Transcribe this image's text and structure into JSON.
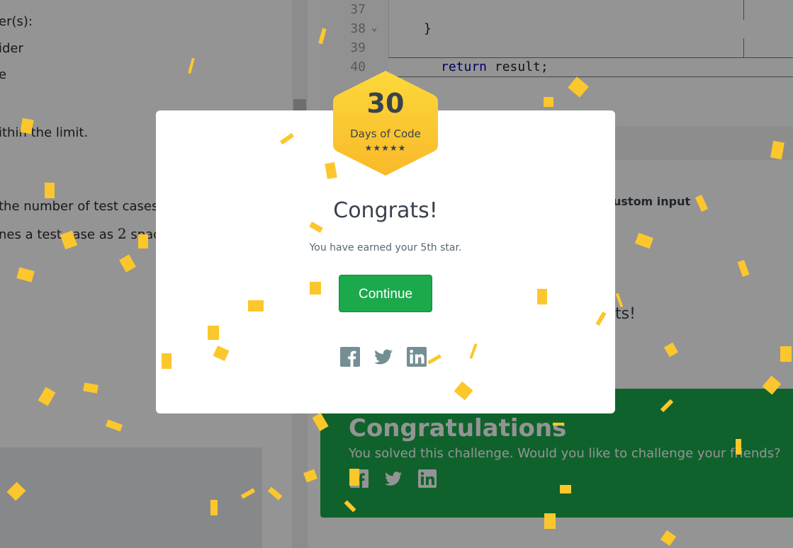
{
  "problem": {
    "lines": [
      {
        "text": "er(s):"
      },
      {
        "text": "ider"
      },
      {
        "text": "e"
      },
      {
        "text": "ithin the limit."
      },
      {
        "text": "the number of test cases."
      },
      {
        "pre": "nes a test case as ",
        "math": "2",
        "post": " space-"
      }
    ]
  },
  "editor": {
    "rows": [
      {
        "ln": "37",
        "fold": "",
        "code": ""
      },
      {
        "ln": "38",
        "fold": "⌄",
        "code": "}"
      },
      {
        "ln": "39",
        "fold": "",
        "code": ""
      },
      {
        "ln": "40",
        "fold": "",
        "kw": "return",
        "code": " result;"
      }
    ]
  },
  "custom_input_label": "ustom input",
  "partial_text": "ts!",
  "banner": {
    "title": "Congratulations",
    "subtitle": "You solved this challenge. Would you like to challenge your friends?",
    "icons": [
      "facebook-icon",
      "twitter-icon",
      "linkedin-icon"
    ]
  },
  "modal": {
    "badge_number": "30",
    "badge_label": "Days of Code",
    "badge_stars": "★★★★★",
    "title": "Congrats!",
    "subtitle": "You have earned your 5th star.",
    "continue_label": "Continue",
    "share_icons": [
      "facebook-icon",
      "twitter-icon",
      "linkedin-icon"
    ]
  },
  "colors": {
    "accent_green": "#1ba94c",
    "badge_yellow": "#fcc72c",
    "text_dark": "#39424e",
    "icon_gray": "#738f93"
  }
}
